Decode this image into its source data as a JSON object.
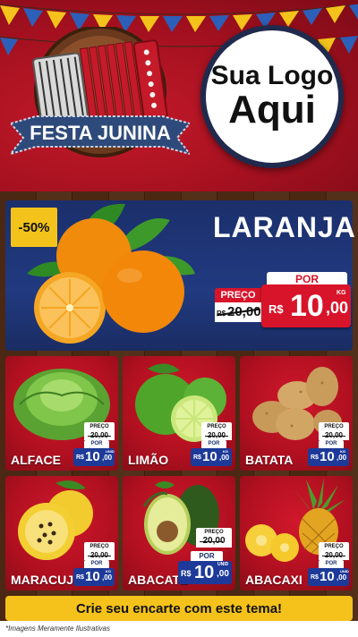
{
  "header": {
    "banner_text": "FESTA JUNINA",
    "logo_line1": "Sua Logo",
    "logo_line2": "Aqui"
  },
  "hero": {
    "discount": "-50%",
    "title": "LARANJA",
    "preco_label": "PREÇO",
    "old_currency": "R$",
    "old_value": "20,00",
    "por_label": "POR",
    "currency": "R$",
    "price_int": "10",
    "price_dec": ",00",
    "unit": "KG"
  },
  "tiles": [
    {
      "name": "ALFACE",
      "preco_label": "PREÇO",
      "old": "20,00",
      "por": "POR",
      "currency": "R$",
      "int": "10",
      "dec": ",00",
      "unit": "UNID"
    },
    {
      "name": "LIMÃO",
      "preco_label": "PREÇO",
      "old": "20,00",
      "por": "POR",
      "currency": "R$",
      "int": "10",
      "dec": ",00",
      "unit": "KG"
    },
    {
      "name": "BATATA",
      "preco_label": "PREÇO",
      "old": "20,00",
      "por": "POR",
      "currency": "R$",
      "int": "10",
      "dec": ",00",
      "unit": "KG"
    },
    {
      "name": "MARACUJÁ",
      "preco_label": "PREÇO",
      "old": "20,00",
      "por": "POR",
      "currency": "R$",
      "int": "10",
      "dec": ",00",
      "unit": "KG"
    },
    {
      "name": "ABACATE",
      "preco_label": "PREÇO",
      "old": "20,00",
      "por": "POR",
      "currency": "R$",
      "int": "10",
      "dec": ",00",
      "unit": "UNID"
    },
    {
      "name": "ABACAXI",
      "preco_label": "PREÇO",
      "old": "20,00",
      "por": "POR",
      "currency": "R$",
      "int": "10",
      "dec": ",00",
      "unit": "UNID"
    }
  ],
  "cta": "Crie seu encarte com este tema!",
  "footer": "*Imagens Meramente Ilustrativas",
  "colors": {
    "header_red": "#b01020",
    "hero_blue": "#1b2f6b",
    "price_red": "#d8142a",
    "price_blue": "#1d3a99",
    "accent_yellow": "#f4c21b"
  }
}
